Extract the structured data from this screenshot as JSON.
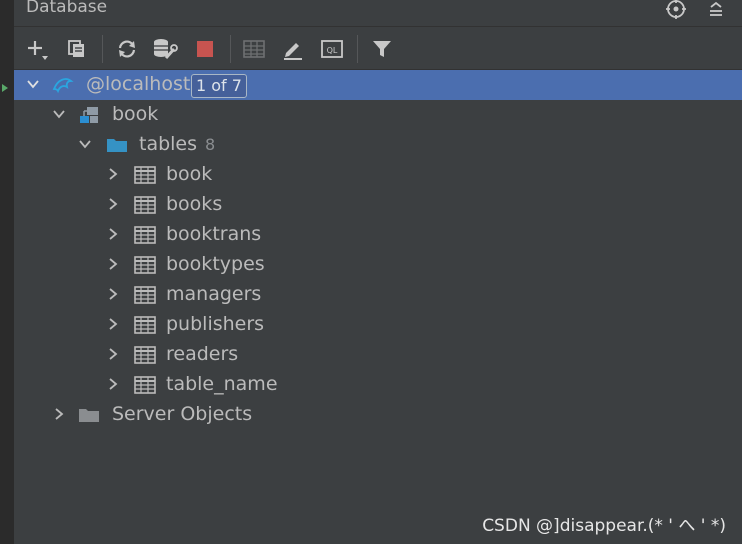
{
  "panel": {
    "title": "Database"
  },
  "toolbar_icons": [
    "add-icon",
    "duplicate-icon",
    "refresh-icon",
    "sync-schema-icon",
    "stop-icon",
    "table-editor-icon",
    "edit-icon",
    "query-console-icon",
    "filter-icon"
  ],
  "colors": {
    "selection": "#4b6eaf",
    "background": "#3c3f41",
    "stop": "#c75450",
    "folder": "#3592c4"
  },
  "tree": {
    "host": {
      "label": "@localhost",
      "badge": "1 of 7"
    },
    "schema": {
      "label": "book"
    },
    "tables_folder": {
      "label": "tables",
      "count": "8"
    },
    "tables": [
      "book",
      "books",
      "booktrans",
      "booktypes",
      "managers",
      "publishers",
      "readers",
      "table_name"
    ],
    "server_objects": {
      "label": "Server Objects"
    }
  },
  "watermark": "CSDN @]disappear.(* ' へ ' *)"
}
